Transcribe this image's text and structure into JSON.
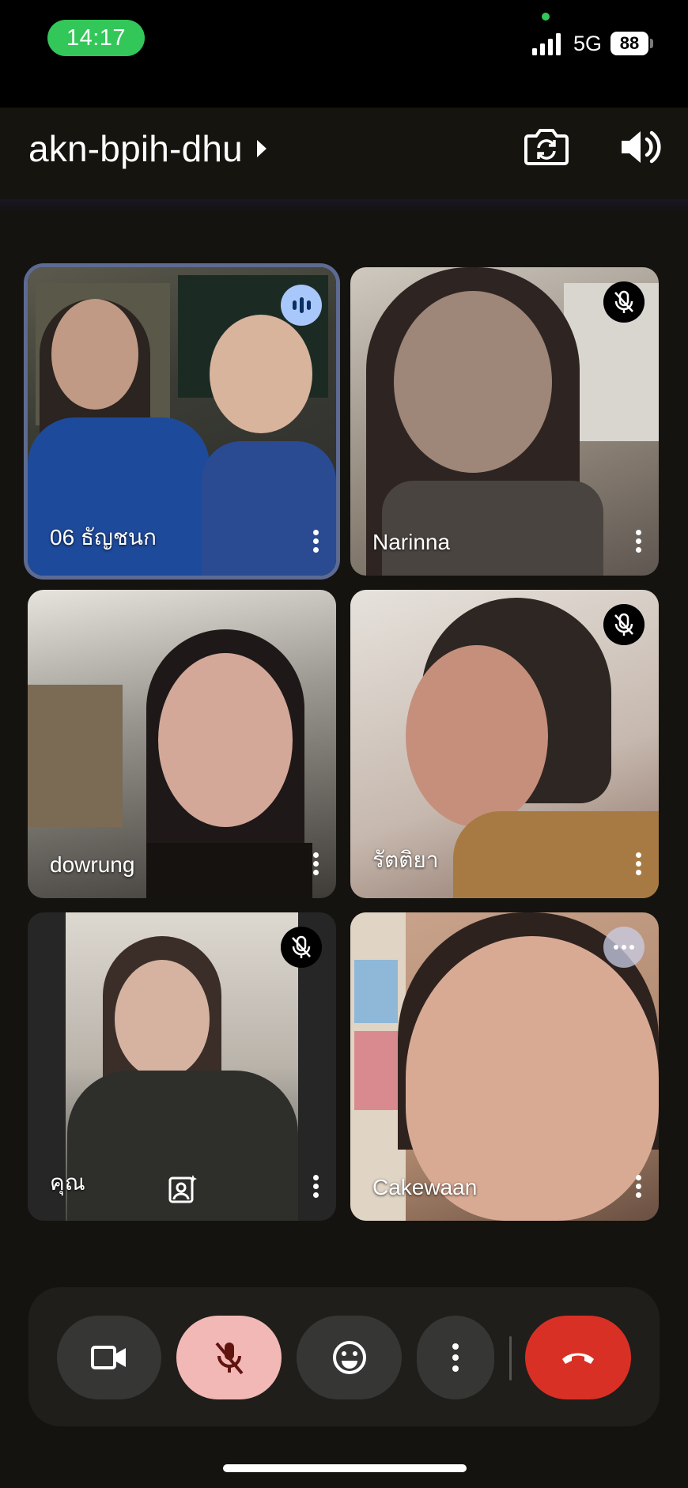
{
  "status_bar": {
    "time": "14:17",
    "network": "5G",
    "battery": "88"
  },
  "header": {
    "meeting_code": "akn-bpih-dhu",
    "icons": [
      "flip-camera-icon",
      "speaker-volume-icon"
    ]
  },
  "participants": [
    {
      "name": "06 ธัญชนก",
      "status": "speaking",
      "active": true
    },
    {
      "name": "Narinna",
      "status": "muted"
    },
    {
      "name": "dowrung",
      "status": "none"
    },
    {
      "name": "รัตติยา",
      "status": "muted"
    },
    {
      "name": "คุณ",
      "status": "muted",
      "is_self": true
    },
    {
      "name": "Cakewaan",
      "status": "more"
    }
  ],
  "controls": {
    "icons": [
      "video-camera-icon",
      "microphone-off-icon",
      "emoji-reaction-icon",
      "more-options-icon",
      "end-call-icon"
    ]
  },
  "colors": {
    "accent_green": "#33c759",
    "mic_off_bg": "#f2b8b5",
    "end_call": "#d93025",
    "speaking_badge": "#a8c7fa"
  }
}
